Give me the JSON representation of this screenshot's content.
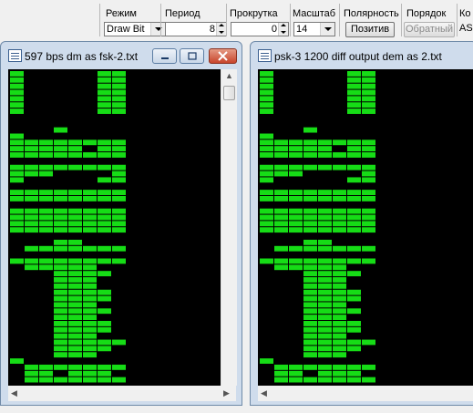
{
  "toolbar": {
    "mode": {
      "label": "Режим",
      "value": "Draw Bit"
    },
    "period": {
      "label": "Период",
      "value": "8"
    },
    "scroll": {
      "label": "Прокрутка",
      "value": "0"
    },
    "scale": {
      "label": "Масштаб",
      "value": "14"
    },
    "polarity": {
      "label": "Полярность",
      "button": "Позитив"
    },
    "order": {
      "label": "Порядок",
      "button": "Обратный"
    },
    "code": {
      "label": "Ко",
      "value": "AS"
    }
  },
  "windows": [
    {
      "title": "597 bps dm as fsk-2.txt"
    },
    {
      "title": "psk-3 1200 diff output dem as 2.txt"
    }
  ],
  "bit_display": {
    "rows": 50,
    "columns": 8,
    "bit_color": "#16dc16",
    "background": "#000000",
    "row_patterns": [
      "10000011",
      "10000011",
      "10000011",
      "10000011",
      "10000011",
      "10000011",
      "10000011",
      "00000000",
      "00000000",
      "00010000",
      "10000000",
      "11111111",
      "11111011",
      "11111111",
      "00000000",
      "11111111",
      "11100001",
      "10000011",
      "00000000",
      "11111111",
      "11111111",
      "00000000",
      "11111111",
      "11111111",
      "11111111",
      "11111111",
      "00000000",
      "00011000",
      "01111111",
      "00000000",
      "11111111",
      "01111100",
      "00011110",
      "00011100",
      "00011100",
      "00011110",
      "00011110",
      "00011100",
      "00011110",
      "00011100",
      "00011110",
      "00011110",
      "00011100",
      "00011111",
      "00011110",
      "00011100",
      "10000000",
      "01111111",
      "01101110",
      "01111111"
    ]
  }
}
